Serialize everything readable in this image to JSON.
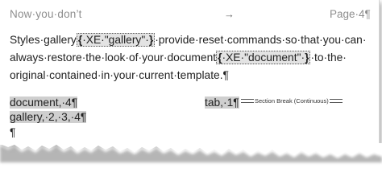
{
  "header": {
    "left_text": "Now·you·don’t",
    "tab_arrow": "→",
    "right_text": "Page·4¶"
  },
  "paragraph": {
    "line1": {
      "a": "Styles·gallery",
      "field1_open": "{",
      "field1_code": "·XE·\"gallery\"·",
      "field1_close": "}",
      "b": "·provide·reset·commands·so·that·you·can·"
    },
    "line2": {
      "a": "always·restore·the·look·of·your·document",
      "field2_open": "{",
      "field2_code": "·XE·\"document\"·",
      "field2_close": "}",
      "b": "·to·the·"
    },
    "line3": {
      "a": "original·contained·in·your·current·template.¶"
    }
  },
  "index": {
    "entry1": "document,·4¶",
    "entry2": "gallery,·2,·3,·4¶",
    "entry3": "tab,·1¶",
    "empty_para": "¶"
  },
  "section_break": {
    "label": "Section Break (Continuous)"
  },
  "colors": {
    "field_shading": "#e3e3e3",
    "index_shading": "#cfcfcf",
    "header_text": "#8e8e8e"
  }
}
